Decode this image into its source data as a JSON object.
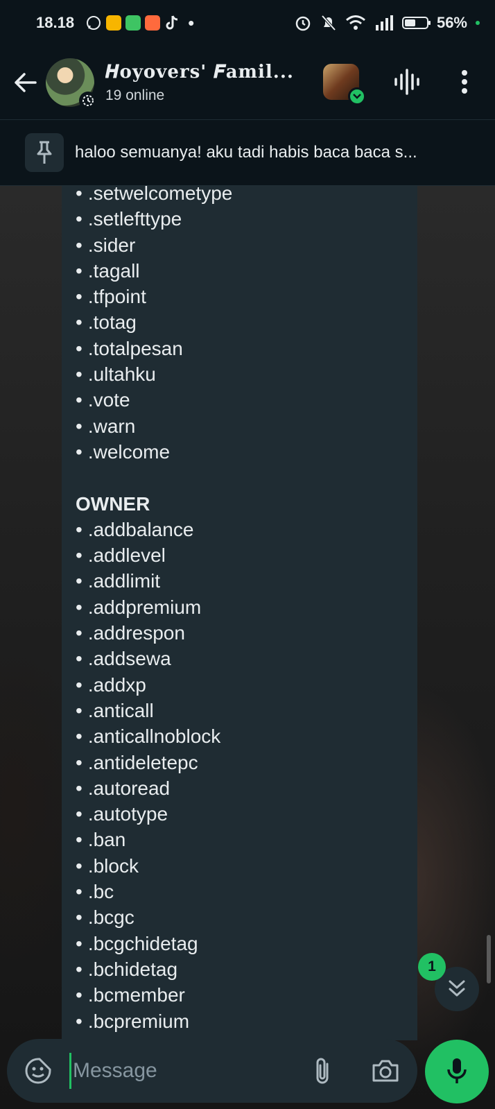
{
  "status_bar": {
    "time": "18.18",
    "battery": "56%",
    "battery_level": 0.56,
    "notification_dot": "•",
    "app_icons": [
      "whatsapp-icon",
      "shopee-icon",
      "greenapp-icon",
      "gallery-icon",
      "tiktok-icon"
    ],
    "system_icons": [
      "alarm-icon",
      "bell-off-icon",
      "wifi-icon",
      "signal-icon",
      "battery-icon"
    ]
  },
  "header": {
    "title": "𝑯oyovers' 𝑭amil...",
    "subtitle": "19 online"
  },
  "pinned": {
    "text": "haloo semuanya! aku tadi habis baca baca s..."
  },
  "messages": {
    "group_commands": [
      ".setwelcometype",
      ".setlefttype",
      ".sider",
      ".tagall",
      ".tfpoint",
      ".totag",
      ".totalpesan",
      ".ultahku",
      ".vote",
      ".warn",
      ".welcome"
    ],
    "owner_heading": "OWNER",
    "owner_commands": [
      ".addbalance",
      ".addlevel",
      ".addlimit",
      ".addpremium",
      ".addrespon",
      ".addsewa",
      ".addxp",
      ".anticall",
      ".anticallnoblock",
      ".antideletepc",
      ".autoread",
      ".autotype",
      ".ban",
      ".block",
      ".bc",
      ".bcgc",
      ".bcgchidetag",
      ".bchidetag",
      ".bcmember",
      ".bcpremium"
    ]
  },
  "unread_count": "1",
  "composer": {
    "placeholder": "Message"
  },
  "colors": {
    "background": "#0b141a",
    "bubble": "#1f2c33",
    "accent": "#21c063",
    "text": "#e9edef"
  }
}
